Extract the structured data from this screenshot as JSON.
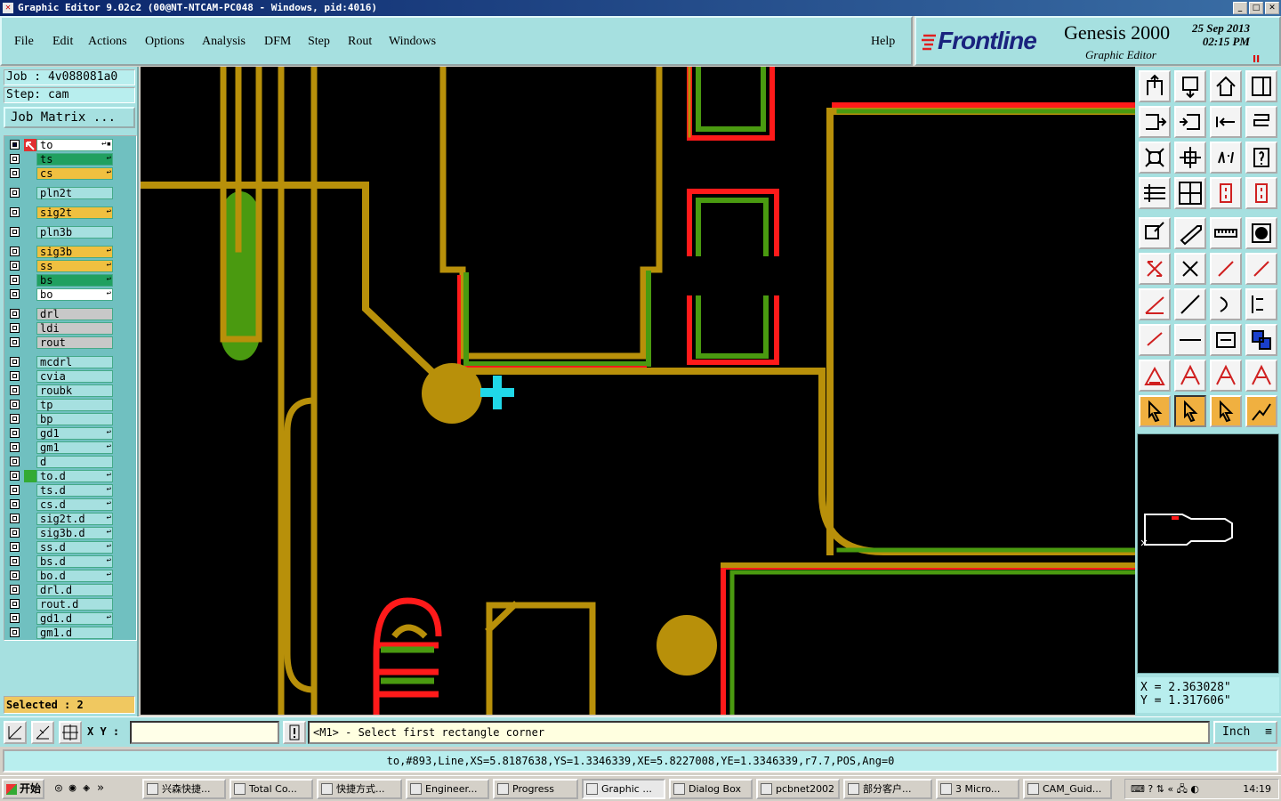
{
  "window": {
    "title": "Graphic Editor 9.02c2 (00@NT-NTCAM-PC048 - Windows, pid:4016)"
  },
  "menu": [
    "File",
    "Edit",
    "Actions",
    "Options",
    "Analysis",
    "DFM",
    "Step",
    "Rout",
    "Windows"
  ],
  "help_label": "Help",
  "brand": {
    "logo": "Frontline",
    "product": "Genesis 2000",
    "subtitle": "Graphic Editor",
    "date": "25 Sep 2013",
    "time": "02:15 PM",
    "pause": "II"
  },
  "job": {
    "job_label": "Job : 4v088081a0",
    "step_label": "Step: cam",
    "matrix_button": "Job Matrix ..."
  },
  "layers": [
    {
      "name": "to",
      "color": "#ffffff",
      "mark": "↩▪",
      "affected": true
    },
    {
      "name": "ts",
      "color": "#20a060",
      "mark": "↩"
    },
    {
      "name": "cs",
      "color": "#f0c040",
      "mark": "↩"
    },
    {
      "name": "pln2t",
      "color": "#a6e0e0",
      "mark": ""
    },
    {
      "name": "sig2t",
      "color": "#f0c040",
      "mark": "↩"
    },
    {
      "name": "pln3b",
      "color": "#a6e0e0",
      "mark": ""
    },
    {
      "name": "sig3b",
      "color": "#f0c040",
      "mark": "↩"
    },
    {
      "name": "ss",
      "color": "#f0c040",
      "mark": "↩"
    },
    {
      "name": "bs",
      "color": "#20a060",
      "mark": "↩"
    },
    {
      "name": "bo",
      "color": "#ffffff",
      "mark": "↩"
    },
    {
      "name": "drl",
      "color": "#c8c8c8",
      "mark": ""
    },
    {
      "name": "ldi",
      "color": "#c8c8c8",
      "mark": ""
    },
    {
      "name": "rout",
      "color": "#c8c8c8",
      "mark": ""
    },
    {
      "name": "mcdrl",
      "color": "#a6e0e0",
      "mark": ""
    },
    {
      "name": "cvia",
      "color": "#a6e0e0",
      "mark": ""
    },
    {
      "name": "roubk",
      "color": "#a6e0e0",
      "mark": ""
    },
    {
      "name": "tp",
      "color": "#a6e0e0",
      "mark": ""
    },
    {
      "name": "bp",
      "color": "#a6e0e0",
      "mark": ""
    },
    {
      "name": "gd1",
      "color": "#a6e0e0",
      "mark": "↩"
    },
    {
      "name": "gm1",
      "color": "#a6e0e0",
      "mark": "↩"
    },
    {
      "name": "d",
      "color": "#a6e0e0",
      "mark": ""
    },
    {
      "name": "to.d",
      "color": "#a6e0e0",
      "mark": "↩",
      "work": true
    },
    {
      "name": "ts.d",
      "color": "#a6e0e0",
      "mark": "↩"
    },
    {
      "name": "cs.d",
      "color": "#a6e0e0",
      "mark": "↩"
    },
    {
      "name": "sig2t.d",
      "color": "#a6e0e0",
      "mark": "↩"
    },
    {
      "name": "sig3b.d",
      "color": "#a6e0e0",
      "mark": "↩"
    },
    {
      "name": "ss.d",
      "color": "#a6e0e0",
      "mark": "↩"
    },
    {
      "name": "bs.d",
      "color": "#a6e0e0",
      "mark": "↩"
    },
    {
      "name": "bo.d",
      "color": "#a6e0e0",
      "mark": "↩"
    },
    {
      "name": "drl.d",
      "color": "#a6e0e0",
      "mark": ""
    },
    {
      "name": "rout.d",
      "color": "#a6e0e0",
      "mark": ""
    },
    {
      "name": "gd1.d",
      "color": "#a6e0e0",
      "mark": "↩"
    },
    {
      "name": "gm1.d",
      "color": "#a6e0e0",
      "mark": ""
    }
  ],
  "selected_label": "Selected : 2",
  "coords": {
    "x": "X = 2.363028\"",
    "y": "Y = 1.317606\""
  },
  "command": {
    "xy_label": "X Y :",
    "xy_value": "",
    "prompt": "<M1> - Select first rectangle corner",
    "units": "Inch"
  },
  "status_line": "to,#893,Line,XS=5.8187638,YS=1.3346339,XE=5.8227008,YE=1.3346339,r7.7,POS,Ang=0",
  "taskbar": {
    "start": "开始",
    "tasks": [
      "兴森快捷...",
      "Total Co...",
      "快捷方式...",
      "Engineer...",
      "Progress",
      "Graphic ...",
      "Dialog Box",
      "pcbnet2002",
      "部分客户...",
      "3 Micro...",
      "CAM_Guid..."
    ],
    "active_task": "Graphic ...",
    "clock": "14:19"
  },
  "colors": {
    "copper": "#b8900a",
    "pad_red": "#ff1a1a",
    "trace_green": "#4a9a10",
    "cursor": "#20d8e8",
    "panel": "#a6e0e0"
  }
}
